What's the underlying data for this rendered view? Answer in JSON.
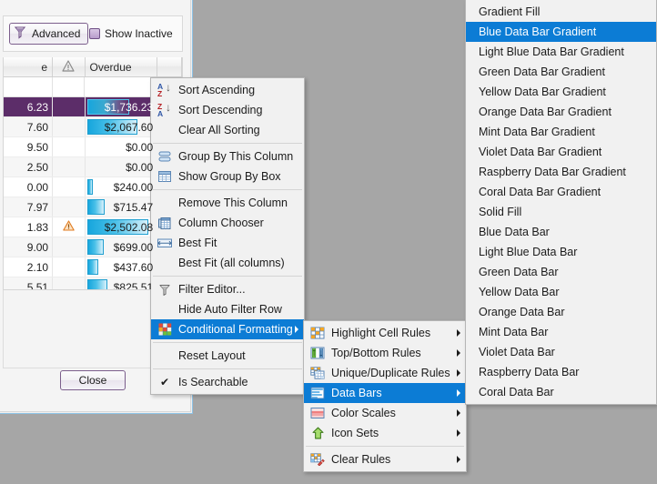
{
  "window": {
    "toolbar": {
      "advanced_label": "Advanced",
      "advanced_icon": "funnel-icon",
      "show_inactive_label": "Show Inactive",
      "show_inactive_checked": true
    },
    "close_label": "Close"
  },
  "grid": {
    "columns": [
      {
        "id": "balance",
        "label": "e",
        "align": "right"
      },
      {
        "id": "warning",
        "label": "",
        "icon": "warning-triangle-icon",
        "align": "center"
      },
      {
        "id": "overdue",
        "label": "Overdue",
        "align": "left"
      },
      {
        "id": "spare",
        "label": "",
        "align": "left"
      }
    ],
    "rows": [
      {
        "balance": "6.23",
        "warning": "",
        "overdue": "$1,736.23",
        "bar_pct": 69,
        "selected": true
      },
      {
        "balance": "7.60",
        "warning": "",
        "overdue": "$2,067.60",
        "bar_pct": 82,
        "selected": false
      },
      {
        "balance": "9.50",
        "warning": "",
        "overdue": "$0.00",
        "bar_pct": 0,
        "selected": false
      },
      {
        "balance": "2.50",
        "warning": "",
        "overdue": "$0.00",
        "bar_pct": 0,
        "selected": false
      },
      {
        "balance": "0.00",
        "warning": "",
        "overdue": "$240.00",
        "bar_pct": 10,
        "selected": false
      },
      {
        "balance": "7.97",
        "warning": "",
        "overdue": "$715.47",
        "bar_pct": 29,
        "selected": false
      },
      {
        "balance": "1.83",
        "warning": "warning-triangle-icon",
        "overdue": "$2,502.08",
        "bar_pct": 100,
        "selected": false
      },
      {
        "balance": "9.00",
        "warning": "",
        "overdue": "$699.00",
        "bar_pct": 28,
        "selected": false
      },
      {
        "balance": "2.10",
        "warning": "",
        "overdue": "$437.60",
        "bar_pct": 18,
        "selected": false
      },
      {
        "balance": "5.51",
        "warning": "",
        "overdue": "$825.51",
        "bar_pct": 33,
        "selected": false
      }
    ]
  },
  "context_menu": {
    "items": [
      {
        "label": "Sort Ascending",
        "icon": "sort-ascending-icon",
        "type": "item"
      },
      {
        "label": "Sort Descending",
        "icon": "sort-descending-icon",
        "type": "item"
      },
      {
        "label": "Clear All Sorting",
        "icon": "",
        "type": "item"
      },
      {
        "label": "",
        "icon": "",
        "type": "separator"
      },
      {
        "label": "Group By This Column",
        "icon": "group-icon",
        "type": "item"
      },
      {
        "label": "Show Group By Box",
        "icon": "group-box-icon",
        "type": "item"
      },
      {
        "label": "",
        "icon": "",
        "type": "separator"
      },
      {
        "label": "Remove This Column",
        "icon": "",
        "type": "item"
      },
      {
        "label": "Column Chooser",
        "icon": "column-chooser-icon",
        "type": "item"
      },
      {
        "label": "Best Fit",
        "icon": "best-fit-icon",
        "type": "item"
      },
      {
        "label": "Best Fit (all columns)",
        "icon": "",
        "type": "item"
      },
      {
        "label": "",
        "icon": "",
        "type": "separator"
      },
      {
        "label": "Filter Editor...",
        "icon": "funnel-icon",
        "type": "item"
      },
      {
        "label": "Hide Auto Filter Row",
        "icon": "",
        "type": "item"
      },
      {
        "label": "Conditional Formatting",
        "icon": "conditional-formatting-icon",
        "type": "item",
        "submenu": true,
        "highlighted": true
      },
      {
        "label": "",
        "icon": "",
        "type": "separator"
      },
      {
        "label": "Reset Layout",
        "icon": "",
        "type": "item"
      },
      {
        "label": "",
        "icon": "",
        "type": "separator"
      },
      {
        "label": "Is Searchable",
        "icon": "check-icon",
        "type": "item",
        "checked": true
      }
    ]
  },
  "conditional_formatting_menu": {
    "items": [
      {
        "label": "Highlight Cell Rules",
        "icon": "highlight-cell-rules-icon",
        "submenu": true
      },
      {
        "label": "Top/Bottom Rules",
        "icon": "top-bottom-rules-icon",
        "submenu": true
      },
      {
        "label": "Unique/Duplicate Rules",
        "icon": "unique-duplicate-rules-icon",
        "submenu": true
      },
      {
        "label": "Data Bars",
        "icon": "data-bars-icon",
        "submenu": true,
        "highlighted": true
      },
      {
        "label": "Color Scales",
        "icon": "color-scales-icon",
        "submenu": true
      },
      {
        "label": "Icon Sets",
        "icon": "icon-sets-icon",
        "submenu": true
      },
      {
        "label": "",
        "icon": "",
        "type": "separator"
      },
      {
        "label": "Clear Rules",
        "icon": "clear-rules-icon",
        "submenu": true
      }
    ]
  },
  "data_bars_menu": {
    "items": [
      {
        "label": "Gradient Fill",
        "type": "header"
      },
      {
        "label": "Blue Data Bar Gradient",
        "highlighted": true
      },
      {
        "label": "Light Blue Data Bar Gradient"
      },
      {
        "label": "Green Data Bar Gradient"
      },
      {
        "label": "Yellow Data Bar Gradient"
      },
      {
        "label": "Orange Data Bar Gradient"
      },
      {
        "label": "Mint Data Bar Gradient"
      },
      {
        "label": "Violet Data Bar Gradient"
      },
      {
        "label": "Raspberry Data Bar Gradient"
      },
      {
        "label": "Coral Data Bar Gradient"
      },
      {
        "label": "Solid Fill",
        "type": "header"
      },
      {
        "label": "Blue Data Bar"
      },
      {
        "label": "Light Blue Data Bar"
      },
      {
        "label": "Green Data Bar"
      },
      {
        "label": "Yellow Data Bar"
      },
      {
        "label": "Orange Data Bar"
      },
      {
        "label": "Mint Data Bar"
      },
      {
        "label": "Violet Data Bar"
      },
      {
        "label": "Raspberry Data Bar"
      },
      {
        "label": "Coral Data Bar"
      }
    ]
  },
  "colors": {
    "menu_highlight": "#0c7cd5",
    "row_selection": "#5c2d69",
    "data_bar": "#17a6dd",
    "accent_purple": "#7b5e8c"
  }
}
